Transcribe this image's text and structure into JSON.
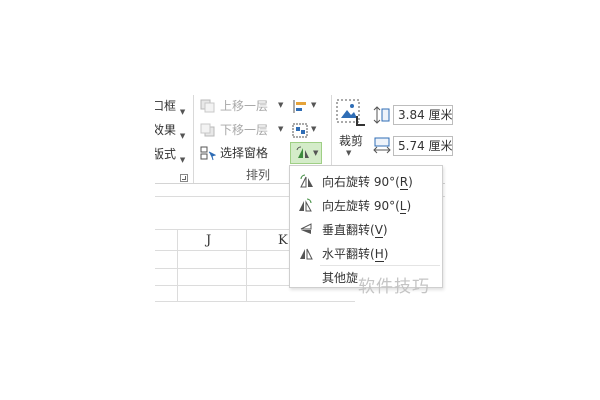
{
  "ribbon": {
    "left_partial": {
      "row1": "口框",
      "row2": "效果",
      "row3": "版式"
    },
    "arrange_group": {
      "bring_forward": "上移一层",
      "send_backward": "下移一层",
      "selection_pane": "选择窗格",
      "group_label": "排列"
    },
    "size_group": {
      "crop_label": "裁剪",
      "height_value": "3.84 厘米",
      "width_value": "5.74 厘米"
    }
  },
  "rotate_menu": {
    "items": [
      {
        "label": "向右旋转 90°",
        "key": "R"
      },
      {
        "label": "向左旋转 90°",
        "key": "L"
      },
      {
        "label": "垂直翻转",
        "key": "V"
      },
      {
        "label": "水平翻转",
        "key": "H"
      },
      {
        "label": "其他旋",
        "key": ""
      }
    ]
  },
  "sheet": {
    "columns": [
      "J",
      "K"
    ]
  },
  "watermark": "软件技巧",
  "colors": {
    "button_highlight": "#d4ecc9",
    "button_border": "#9fcf85",
    "icon_blue": "#2f6db5",
    "icon_green": "#3c8a3c"
  }
}
